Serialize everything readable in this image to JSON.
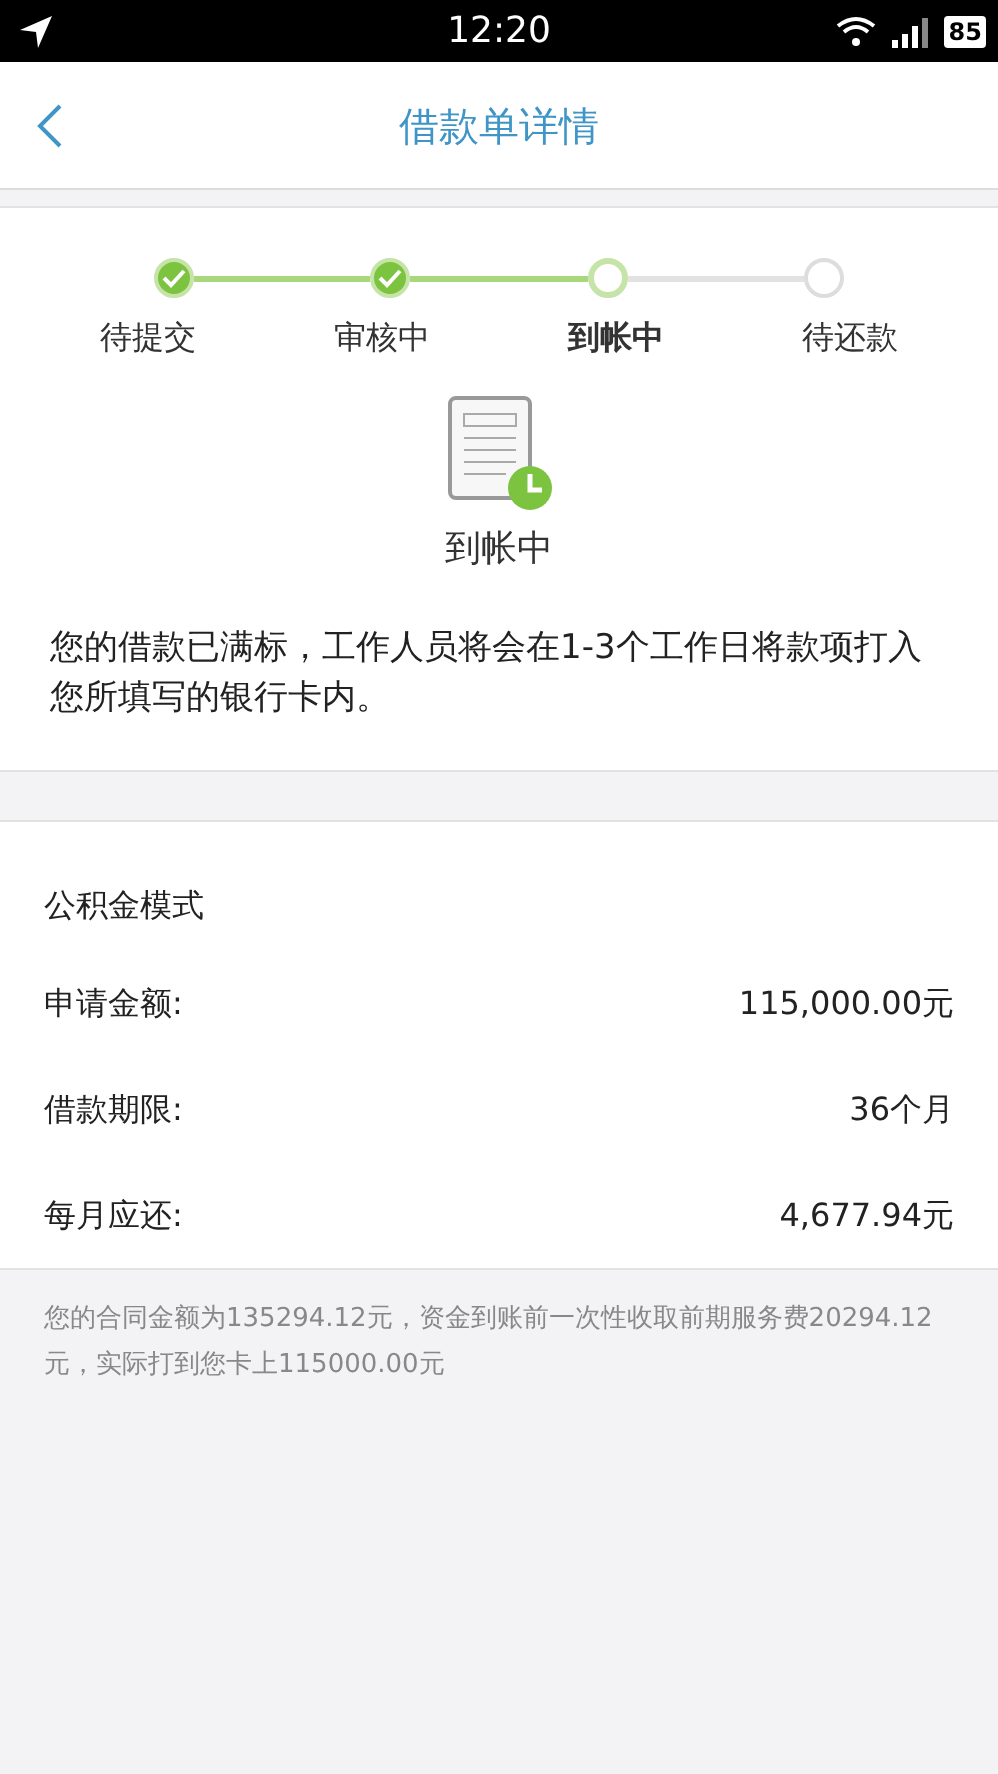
{
  "status_bar": {
    "time": "12:20",
    "battery": "85"
  },
  "nav": {
    "title": "借款单详情"
  },
  "steps": [
    {
      "label": "待提交",
      "done": true,
      "selected": false
    },
    {
      "label": "审核中",
      "done": true,
      "selected": false
    },
    {
      "label": "到帐中",
      "done": false,
      "selected": true
    },
    {
      "label": "待还款",
      "done": false,
      "selected": false
    }
  ],
  "status": {
    "label": "到帐中",
    "message": "您的借款已满标，工作人员将会在1-3个工作日将款项打入您所填写的银行卡内。"
  },
  "details": {
    "title": "公积金模式",
    "rows": [
      {
        "label": "申请金额:",
        "value": "115,000.00元"
      },
      {
        "label": "借款期限:",
        "value": "36个月"
      },
      {
        "label": "每月应还:",
        "value": "4,677.94元"
      }
    ]
  },
  "note": "您的合同金额为135294.12元，资金到账前一次性收取前期服务费20294.12元，实际打到您卡上115000.00元"
}
